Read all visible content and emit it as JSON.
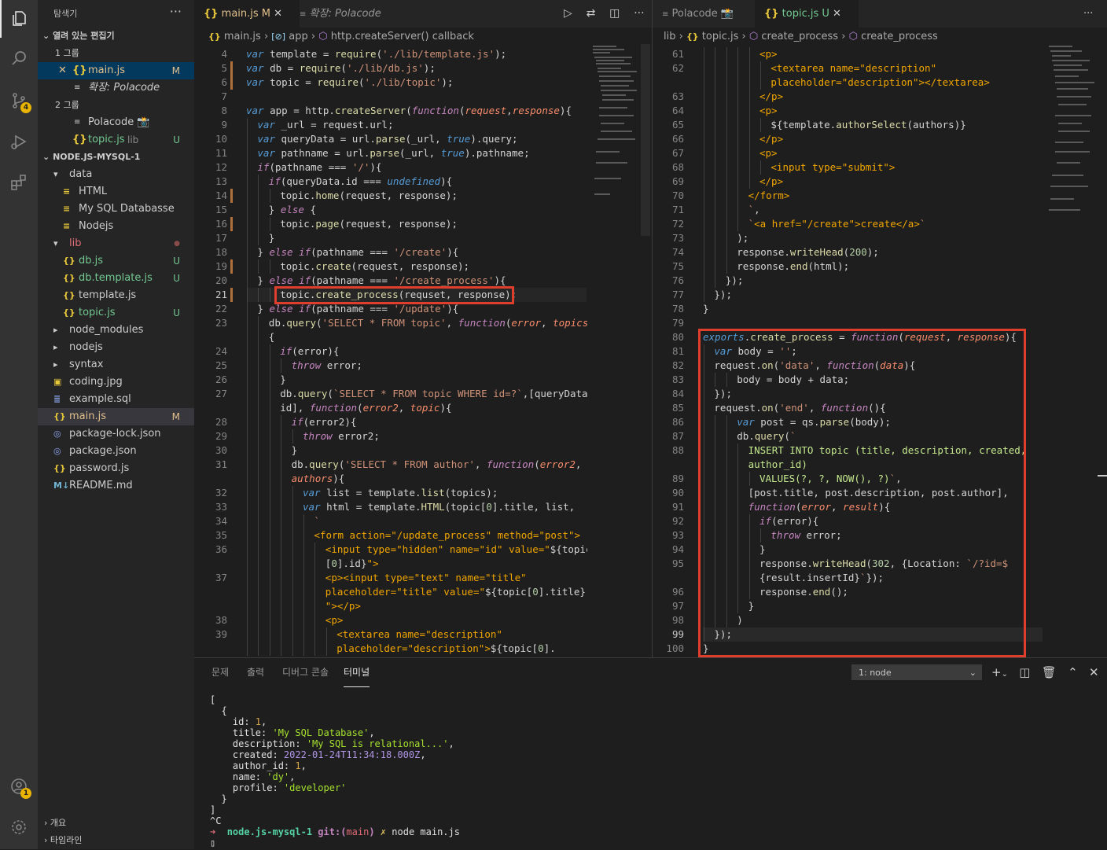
{
  "activity": {
    "scm_badge": "4",
    "account_badge": "1"
  },
  "sidebar": {
    "title": "탐색기",
    "more": "···",
    "open_editors": "열려 있는 편집기",
    "group1": "1 그룹",
    "g1_file1": "main.js",
    "g1_file1_status": "M",
    "g1_file2": "확장: Polacode",
    "group2": "2 그룹",
    "g2_file1": "Polacode 📸",
    "g2_file2": "topic.js",
    "g2_file2_dir": "lib",
    "g2_file2_status": "U",
    "project": "NODE.JS-MYSQL-1",
    "tree": [
      {
        "label": "data",
        "kind": "folder",
        "indent": 1,
        "open": true
      },
      {
        "label": "HTML",
        "kind": "file-text",
        "indent": 2
      },
      {
        "label": "My SQL Databasse",
        "kind": "file-text",
        "indent": 2
      },
      {
        "label": "Nodejs",
        "kind": "file-text",
        "indent": 2
      },
      {
        "label": "lib",
        "kind": "folder",
        "indent": 1,
        "open": true,
        "dot": "●"
      },
      {
        "label": "db.js",
        "kind": "js",
        "indent": 2,
        "status": "U"
      },
      {
        "label": "db.template.js",
        "kind": "js",
        "indent": 2,
        "status": "U"
      },
      {
        "label": "template.js",
        "kind": "js-plain",
        "indent": 2
      },
      {
        "label": "topic.js",
        "kind": "js",
        "indent": 2,
        "status": "U"
      },
      {
        "label": "node_modules",
        "kind": "folder",
        "indent": 1,
        "open": false
      },
      {
        "label": "nodejs",
        "kind": "folder",
        "indent": 1,
        "open": false
      },
      {
        "label": "syntax",
        "kind": "folder",
        "indent": 1,
        "open": false
      },
      {
        "label": "coding.jpg",
        "kind": "img",
        "indent": 1
      },
      {
        "label": "example.sql",
        "kind": "db",
        "indent": 1
      },
      {
        "label": "main.js",
        "kind": "js",
        "indent": 1,
        "status": "M"
      },
      {
        "label": "package-lock.json",
        "kind": "json",
        "indent": 1
      },
      {
        "label": "package.json",
        "kind": "json",
        "indent": 1
      },
      {
        "label": "password.js",
        "kind": "js-plain",
        "indent": 1
      },
      {
        "label": "README.md",
        "kind": "md",
        "indent": 1
      }
    ],
    "outline": "개요",
    "timeline": "타임라인"
  },
  "left_editor": {
    "tab1": "main.js",
    "tab1_status": "M",
    "tab2": "확장: Polacode",
    "crumb_file": "main.js",
    "crumb_a": "app",
    "crumb_b": "http.createServer() callback",
    "lines": [
      {
        "n": "4",
        "h": "<span class=kw>var</span> template = <span class=fn>require</span>(<span class=st>'./lib/template.js'</span>);",
        "i": 0
      },
      {
        "n": "5",
        "h": "<span class=kw>var</span> db = <span class=fn>require</span>(<span class=st>'./lib/db.js'</span>);",
        "i": 0
      },
      {
        "n": "6",
        "h": "<span class=kw>var</span> topic = <span class=fn>require</span>(<span class=st>'./lib/topic'</span>);",
        "i": 0
      },
      {
        "n": "7",
        "h": "",
        "i": 0
      },
      {
        "n": "8",
        "h": "<span class=kw>var</span> app = http.<span class=fn>createServer</span>(<span class=fk>function</span>(<span class=par>request</span>,<span class=par>response</span>){",
        "i": 0
      },
      {
        "n": "9",
        "h": "<span class=kw>var</span> _url = request.url;",
        "i": 1
      },
      {
        "n": "10",
        "h": "<span class=kw>var</span> queryData = url.<span class=fn>parse</span>(_url, <span class=kw>true</span>).query;",
        "i": 1
      },
      {
        "n": "11",
        "h": "<span class=kw>var</span> pathname = url.<span class=fn>parse</span>(_url, <span class=kw>true</span>).pathname;",
        "i": 1
      },
      {
        "n": "12",
        "h": "<span class=fk>if</span>(pathname === <span class=st>'/'</span>){",
        "i": 1
      },
      {
        "n": "13",
        "h": "<span class=fk>if</span>(queryData.id === <span class=kw>undefined</span>){",
        "i": 2
      },
      {
        "n": "14",
        "h": "topic.<span class=fn>home</span>(request, response);",
        "i": 3
      },
      {
        "n": "15",
        "h": "} <span class=fk>else</span> {",
        "i": 2
      },
      {
        "n": "16",
        "h": "topic.<span class=fn>page</span>(request, response);",
        "i": 3
      },
      {
        "n": "17",
        "h": "}",
        "i": 2
      },
      {
        "n": "18",
        "h": "} <span class=fk>else if</span>(pathname === <span class=st>'/create'</span>){",
        "i": 1
      },
      {
        "n": "19",
        "h": "topic.<span class=fn>create</span>(request, response);",
        "i": 3
      },
      {
        "n": "20",
        "h": "} <span class=fk>else if</span>(pathname === <span class=st>'/create_process'</span>){",
        "i": 1
      },
      {
        "n": "21",
        "h": "topic.<span class=fn>create_process</span>(requset, response);",
        "i": 3
      },
      {
        "n": "22",
        "h": "} <span class=fk>else if</span>(pathname === <span class=st>'/update'</span>){",
        "i": 1
      },
      {
        "n": "23",
        "h": "db.<span class=fn>query</span>(<span class=st>'SELECT * FROM topic'</span>, <span class=fk>function</span>(<span class=par>error</span>, <span class=par>topics</span>)",
        "i": 2
      },
      {
        "n": "",
        "h": "{",
        "i": 2
      },
      {
        "n": "24",
        "h": "<span class=fk>if</span>(error){",
        "i": 3
      },
      {
        "n": "25",
        "h": "<span class=fk>throw</span> error;",
        "i": 4
      },
      {
        "n": "26",
        "h": "}",
        "i": 3
      },
      {
        "n": "27",
        "h": "db.<span class=fn>query</span>(<span class=st>`SELECT * FROM topic WHERE id=?`</span>,[queryData.",
        "i": 3
      },
      {
        "n": "",
        "h": "id], <span class=fk>function</span>(<span class=par>error2</span>, <span class=par>topic</span>){",
        "i": 3
      },
      {
        "n": "28",
        "h": "<span class=fk>if</span>(error2){",
        "i": 4
      },
      {
        "n": "29",
        "h": "<span class=fk>throw</span> error2;",
        "i": 5
      },
      {
        "n": "30",
        "h": "}",
        "i": 4
      },
      {
        "n": "31",
        "h": "db.<span class=fn>query</span>(<span class=st>'SELECT * FROM author'</span>, <span class=fk>function</span>(<span class=par>error2</span>,",
        "i": 4
      },
      {
        "n": "",
        "h": "<span class=par>authors</span>){",
        "i": 4
      },
      {
        "n": "32",
        "h": "<span class=kw>var</span> list = template.<span class=fn>list</span>(topics);",
        "i": 5
      },
      {
        "n": "33",
        "h": "<span class=kw>var</span> html = template.<span class=fn>HTML</span>(topic[<span class=num>0</span>].title, list,",
        "i": 5
      },
      {
        "n": "34",
        "h": "<span class=st>`</span>",
        "i": 6
      },
      {
        "n": "35",
        "h": "<span class=tag>&lt;form action=\"/update_process\" method=\"post\"&gt;</span>",
        "i": 6
      },
      {
        "n": "36",
        "h": "<span class=tag>&lt;input type=\"hidden\" name=\"id\" value=\"</span>${topic",
        "i": 7
      },
      {
        "n": "",
        "h": "[<span class=num>0</span>].id}<span class=tag>\"&gt;</span>",
        "i": 7
      },
      {
        "n": "37",
        "h": "<span class=tag>&lt;p&gt;&lt;input type=\"text\" name=\"title\"</span>",
        "i": 7
      },
      {
        "n": "",
        "h": "<span class=tag>placeholder=\"title\" value=\"</span>${topic[<span class=num>0</span>].title}",
        "i": 7
      },
      {
        "n": "",
        "h": "<span class=tag>\"&gt;&lt;/p&gt;</span>",
        "i": 7
      },
      {
        "n": "38",
        "h": "<span class=tag>&lt;p&gt;</span>",
        "i": 7
      },
      {
        "n": "39",
        "h": "<span class=tag>&lt;textarea name=\"description\"</span>",
        "i": 8
      },
      {
        "n": "",
        "h": "<span class=tag>placeholder=\"description\"&gt;</span>${topic[<span class=num>0</span>].",
        "i": 8
      }
    ]
  },
  "right_editor": {
    "tab1": "Polacode 📸",
    "tab2": "topic.js",
    "tab2_status": "U",
    "crumb_a": "lib",
    "crumb_file": "topic.js",
    "crumb_b": "create_process",
    "crumb_c": "create_process",
    "lines": [
      {
        "n": "61",
        "h": "<span class=tag>&lt;p&gt;</span>",
        "i": 5
      },
      {
        "n": "62",
        "h": "<span class=tag>&lt;textarea name=\"description\"</span>",
        "i": 6
      },
      {
        "n": "",
        "h": "<span class=tag>placeholder=\"description\"&gt;&lt;/textarea&gt;</span>",
        "i": 6
      },
      {
        "n": "63",
        "h": "<span class=tag>&lt;/p&gt;</span>",
        "i": 5
      },
      {
        "n": "64",
        "h": "<span class=tag>&lt;p&gt;</span>",
        "i": 5
      },
      {
        "n": "65",
        "h": "${template.<span class=fn>authorSelect</span>(authors)}",
        "i": 6
      },
      {
        "n": "66",
        "h": "<span class=tag>&lt;/p&gt;</span>",
        "i": 5
      },
      {
        "n": "67",
        "h": "<span class=tag>&lt;p&gt;</span>",
        "i": 5
      },
      {
        "n": "68",
        "h": "<span class=tag>&lt;input type=\"submit\"&gt;</span>",
        "i": 6
      },
      {
        "n": "69",
        "h": "<span class=tag>&lt;/p&gt;</span>",
        "i": 5
      },
      {
        "n": "70",
        "h": "<span class=tag>&lt;/form&gt;</span>",
        "i": 4
      },
      {
        "n": "71",
        "h": "<span class=st>`</span>,",
        "i": 4
      },
      {
        "n": "72",
        "h": "<span class=st>`</span><span class=tag>&lt;a href=\"/create\"&gt;create&lt;/a&gt;</span><span class=st>`</span>",
        "i": 4
      },
      {
        "n": "73",
        "h": ");",
        "i": 3
      },
      {
        "n": "74",
        "h": "response.<span class=fn>writeHead</span>(<span class=num>200</span>);",
        "i": 3
      },
      {
        "n": "75",
        "h": "response.<span class=fn>end</span>(html);",
        "i": 3
      },
      {
        "n": "76",
        "h": "});",
        "i": 2
      },
      {
        "n": "77",
        "h": "});",
        "i": 1
      },
      {
        "n": "78",
        "h": "}",
        "i": 0
      },
      {
        "n": "79",
        "h": "",
        "i": 0
      },
      {
        "n": "80",
        "h": "<span class=kw>exports</span>.<span class=fn>create_process</span> = <span class=fk>function</span>(<span class=par>request</span>, <span class=par>response</span>){",
        "i": 0
      },
      {
        "n": "81",
        "h": "<span class=kw>var</span> body = <span class=st>''</span>;",
        "i": 1
      },
      {
        "n": "82",
        "h": "request.<span class=fn>on</span>(<span class=st>'data'</span>, <span class=fk>function</span>(<span class=par>data</span>){",
        "i": 1
      },
      {
        "n": "83",
        "h": "body = body + data;",
        "i": 3
      },
      {
        "n": "84",
        "h": "});",
        "i": 1
      },
      {
        "n": "85",
        "h": "request.<span class=fn>on</span>(<span class=st>'end'</span>, <span class=fk>function</span>(){",
        "i": 1
      },
      {
        "n": "86",
        "h": "<span class=kw>var</span> post = qs.<span class=fn>parse</span>(body);",
        "i": 3
      },
      {
        "n": "87",
        "h": "db.<span class=fn>query</span>(<span class=st>`</span>",
        "i": 3
      },
      {
        "n": "88",
        "h": "<span class=tp>INSERT INTO topic (title, description, created,</span>",
        "i": 4
      },
      {
        "n": "",
        "h": "<span class=tp>author_id)</span>",
        "i": 4
      },
      {
        "n": "89",
        "h": "<span class=tp>VALUES(?, ?, NOW(), ?)</span><span class=st>`</span>,",
        "i": 5
      },
      {
        "n": "90",
        "h": "[post.title, post.description, post.author],",
        "i": 4
      },
      {
        "n": "91",
        "h": "<span class=fk>function</span>(<span class=par>error</span>, <span class=par>result</span>){",
        "i": 4
      },
      {
        "n": "92",
        "h": "<span class=fk>if</span>(error){",
        "i": 5
      },
      {
        "n": "93",
        "h": "<span class=fk>throw</span> error;",
        "i": 6
      },
      {
        "n": "94",
        "h": "}",
        "i": 5
      },
      {
        "n": "95",
        "h": "response.<span class=fn>writeHead</span>(<span class=num>302</span>, {Location: <span class=st>`/?id=$</span>",
        "i": 5
      },
      {
        "n": "",
        "h": "{result.insertId}<span class=st>`</span>});",
        "i": 5
      },
      {
        "n": "96",
        "h": "response.<span class=fn>end</span>();",
        "i": 5
      },
      {
        "n": "97",
        "h": "}",
        "i": 4
      },
      {
        "n": "98",
        "h": ")",
        "i": 3
      },
      {
        "n": "99",
        "h": "});",
        "i": 1
      },
      {
        "n": "100",
        "h": "}",
        "i": 0
      }
    ]
  },
  "panel": {
    "tabs": [
      "문제",
      "출력",
      "디버그 콘솔",
      "터미널"
    ],
    "active_tab": "터미널",
    "terminal_select": "1: node",
    "terminal": {
      "l1": "[",
      "l2": "  {",
      "id_key": "    id: ",
      "id_val": "1",
      "title_key": "    title: ",
      "title_val": "'My SQL Database'",
      "desc_key": "    description: ",
      "desc_val": "'My SQL is relational...'",
      "created_key": "    created: ",
      "created_val": "2022-01-24T11:34:18.000Z",
      "author_key": "    author_id: ",
      "author_val": "1",
      "name_key": "    name: ",
      "name_val": "'dy'",
      "profile_key": "    profile: ",
      "profile_val": "'developer'",
      "l10": "  }",
      "l11": "]",
      "l12": "^C",
      "prompt_arrow": "➜",
      "prompt_dir": "node.js-mysql-1",
      "prompt_git": "git:(",
      "prompt_branch": "main",
      "prompt_git_end": ")",
      "prompt_x": "✗",
      "prompt_cmd": "node main.js",
      "cursor": "▯"
    }
  }
}
